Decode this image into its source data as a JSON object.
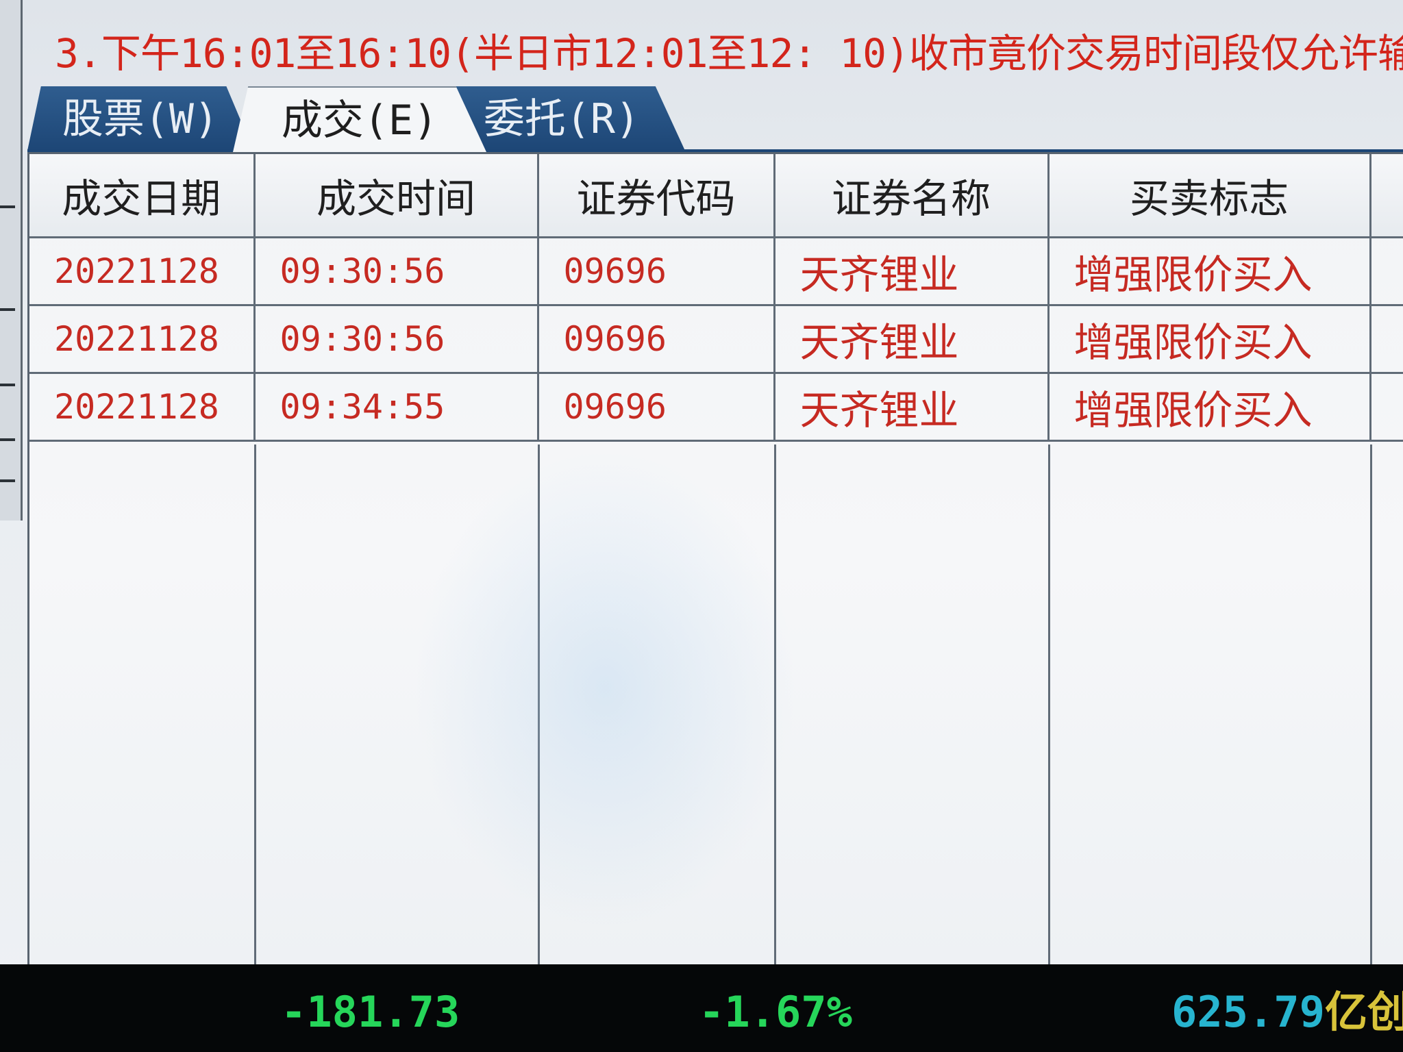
{
  "notice": {
    "text": "3.下午16:01至16:10(半日市12:01至12: 10)收市竟价交易时间段仅允许输"
  },
  "tabs": [
    {
      "label": "股票(W)",
      "active": false
    },
    {
      "label": "成交(E)",
      "active": true
    },
    {
      "label": "委托(R)",
      "active": false
    }
  ],
  "table": {
    "columns": [
      "成交日期",
      "成交时间",
      "证券代码",
      "证券名称",
      "买卖标志"
    ],
    "rows": [
      {
        "date": "20221128",
        "time": "09:30:56",
        "code": "09696",
        "name": "天齐锂业",
        "side": "增强限价买入"
      },
      {
        "date": "20221128",
        "time": "09:30:56",
        "code": "09696",
        "name": "天齐锂业",
        "side": "增强限价买入"
      },
      {
        "date": "20221128",
        "time": "09:34:55",
        "code": "09696",
        "name": "天齐锂业",
        "side": "增强限价买入"
      }
    ]
  },
  "status_bar": {
    "change": "-181.73",
    "change_pct": "-1.67%",
    "amount_value": "625.79",
    "amount_unit": "亿",
    "trailing": "创"
  },
  "colors": {
    "notice_red": "#d3251b",
    "row_text_red": "#c62a22",
    "tab_blue": "#1d4676",
    "status_green": "#26d65a",
    "status_cyan": "#27b4cf",
    "status_yellow": "#d8c33a"
  }
}
